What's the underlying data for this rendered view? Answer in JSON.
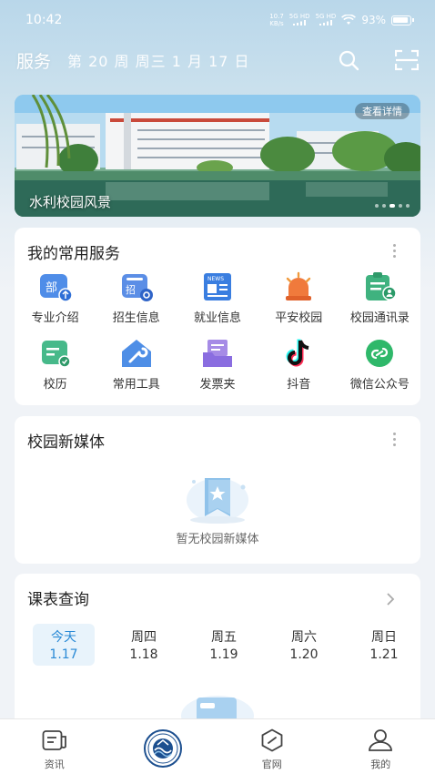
{
  "status_bar": {
    "time": "10:42",
    "speed": "10.7",
    "speed_unit": "KB/s",
    "sim1": "5G HD",
    "sim2": "5G HD",
    "battery": "93%"
  },
  "header": {
    "title": "服务",
    "date": "第 20 周  周三   1 月 17 日",
    "icons": [
      "search-icon",
      "scan-icon"
    ]
  },
  "banner": {
    "detail_label": "查看详情",
    "caption": "水利校园风景",
    "slides": 5,
    "active_slide": 3
  },
  "services": {
    "title": "我的常用服务",
    "items": [
      {
        "label": "专业介绍",
        "icon": "major-intro-icon"
      },
      {
        "label": "招生信息",
        "icon": "enrollment-icon"
      },
      {
        "label": "就业信息",
        "icon": "employment-news-icon"
      },
      {
        "label": "平安校园",
        "icon": "alarm-light-icon"
      },
      {
        "label": "校园通讯录",
        "icon": "contacts-icon"
      },
      {
        "label": "校历",
        "icon": "calendar-icon"
      },
      {
        "label": "常用工具",
        "icon": "tools-icon"
      },
      {
        "label": "发票夹",
        "icon": "invoice-folder-icon"
      },
      {
        "label": "抖音",
        "icon": "douyin-icon"
      },
      {
        "label": "微信公众号",
        "icon": "wechat-official-icon"
      }
    ]
  },
  "media": {
    "title": "校园新媒体",
    "empty_text": "暂无校园新媒体"
  },
  "schedule": {
    "title": "课表查询",
    "days": [
      {
        "name": "今天",
        "date": "1.17",
        "active": true
      },
      {
        "name": "周四",
        "date": "1.18"
      },
      {
        "name": "周五",
        "date": "1.19"
      },
      {
        "name": "周六",
        "date": "1.20"
      },
      {
        "name": "周日",
        "date": "1.21"
      }
    ]
  },
  "bottom_nav": [
    {
      "label": "资讯",
      "icon": "news-icon"
    },
    {
      "label": "",
      "icon": "school-logo-icon"
    },
    {
      "label": "官网",
      "icon": "website-icon"
    },
    {
      "label": "我的",
      "icon": "profile-icon"
    }
  ],
  "colors": {
    "accent": "#2a8ad6",
    "today_bg": "#e8f3fb",
    "page_bg": "#f0f3f7"
  }
}
